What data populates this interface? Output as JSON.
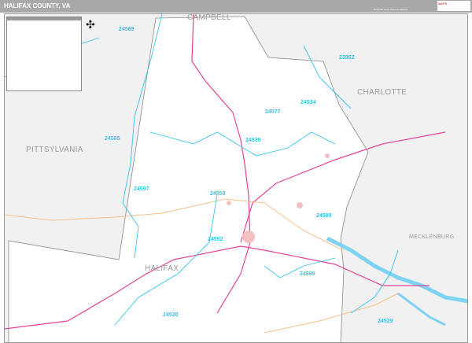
{
  "header": {
    "title": "HALIFAX COUNTY, VA",
    "edition": "2026 ZIP Code Premium Edition",
    "logo": "MAPS"
  },
  "counties": {
    "campbell": "CAMPBELL",
    "charlotte": "CHARLOTTE",
    "pittsylvania": "PITTSYLVANIA",
    "mecklenburg": "MECKLENBURG",
    "halifax": "HALIFAX"
  },
  "zips": [
    "24569",
    "23962",
    "24565",
    "24534",
    "24577",
    "24539",
    "24597",
    "24558",
    "24592",
    "24589",
    "24598",
    "24520",
    "24529"
  ],
  "colors": {
    "zip_boundary": "#33c4ee",
    "highway": "#e0449a",
    "road": "#f5c08a",
    "water": "#7fd3f2"
  }
}
